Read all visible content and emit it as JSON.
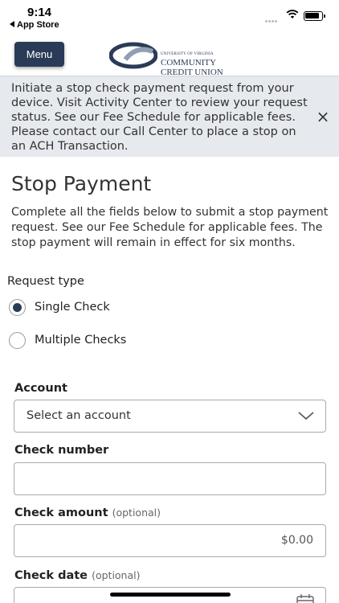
{
  "status_bar": {
    "time": "9:14",
    "back_label": "App Store"
  },
  "header": {
    "menu_label": "Menu",
    "logo": {
      "line1": "UNIVERSITY OF VIRGINIA",
      "line2": "COMMUNITY",
      "line3": "CREDIT UNION"
    }
  },
  "banner": {
    "text": "Initiate a stop check payment request from your device. Visit Activity Center to review your request status. See our Fee Schedule for applicable fees. Please contact our Call Center to place a stop on an ACH Transaction.",
    "close_icon": "×"
  },
  "page": {
    "title": "Stop Payment",
    "intro": "Complete all the fields below to submit a stop payment request. See our Fee Schedule for applicable fees. The stop payment will remain in effect for six months."
  },
  "request_type": {
    "label": "Request type",
    "options": [
      {
        "label": "Single Check",
        "selected": true
      },
      {
        "label": "Multiple Checks",
        "selected": false
      }
    ]
  },
  "form": {
    "account": {
      "label": "Account",
      "value": "Select an account"
    },
    "check_number": {
      "label": "Check number",
      "value": ""
    },
    "check_amount": {
      "label": "Check amount",
      "optional": "(optional)",
      "value": "$0.00"
    },
    "check_date": {
      "label": "Check date",
      "optional": "(optional)"
    }
  },
  "colors": {
    "primary": "#2a3b57",
    "banner_bg": "#e6e9ee"
  }
}
